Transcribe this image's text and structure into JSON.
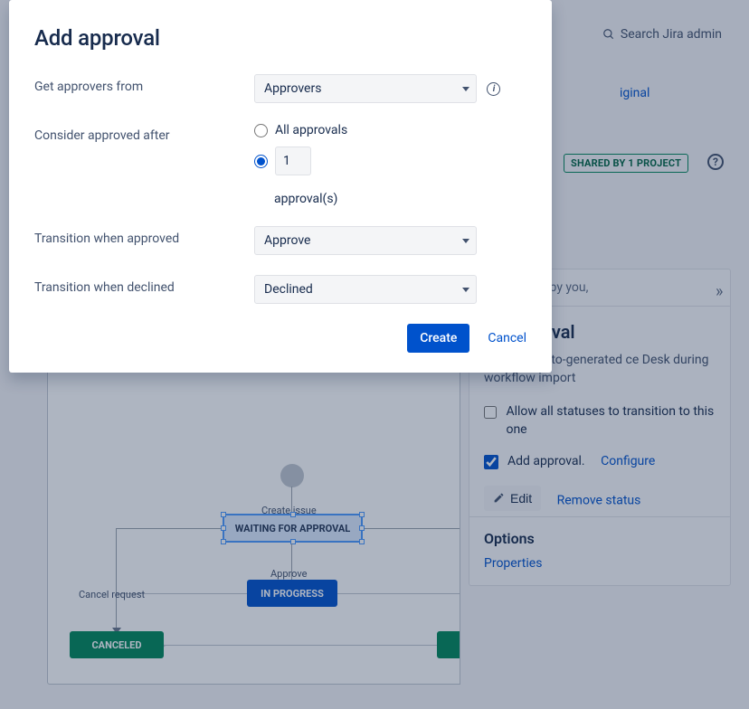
{
  "header": {
    "search_label": "Search Jira admin",
    "original_link": "iginal",
    "shared_badge": "SHARED BY 1 PROJECT"
  },
  "panel": {
    "last_edited": "Last edited by you,",
    "status_title": "or approval",
    "description": "This was auto-generated ce Desk during workflow import",
    "allow_transition": "Allow all statuses to transition to this one",
    "add_approval": "Add approval.",
    "configure": "Configure",
    "edit": "Edit",
    "remove": "Remove status",
    "options_title": "Options",
    "properties": "Properties"
  },
  "diagram": {
    "create_issue": "Create issue",
    "waiting": "WAITING FOR APPROVAL",
    "approve": "Approve",
    "in_progress": "IN PROGRESS",
    "cancel_request": "Cancel request",
    "canceled": "CANCELED"
  },
  "modal": {
    "title": "Add approval",
    "labels": {
      "get_approvers": "Get approvers from",
      "consider_approved": "Consider approved after",
      "transition_approved": "Transition when approved",
      "transition_declined": "Transition when declined"
    },
    "values": {
      "approvers_select": "Approvers",
      "all_approvals": "All approvals",
      "approval_count": "1",
      "approval_suffix": "approval(s)",
      "approved_transition": "Approve",
      "declined_transition": "Declined"
    },
    "buttons": {
      "create": "Create",
      "cancel": "Cancel"
    }
  }
}
